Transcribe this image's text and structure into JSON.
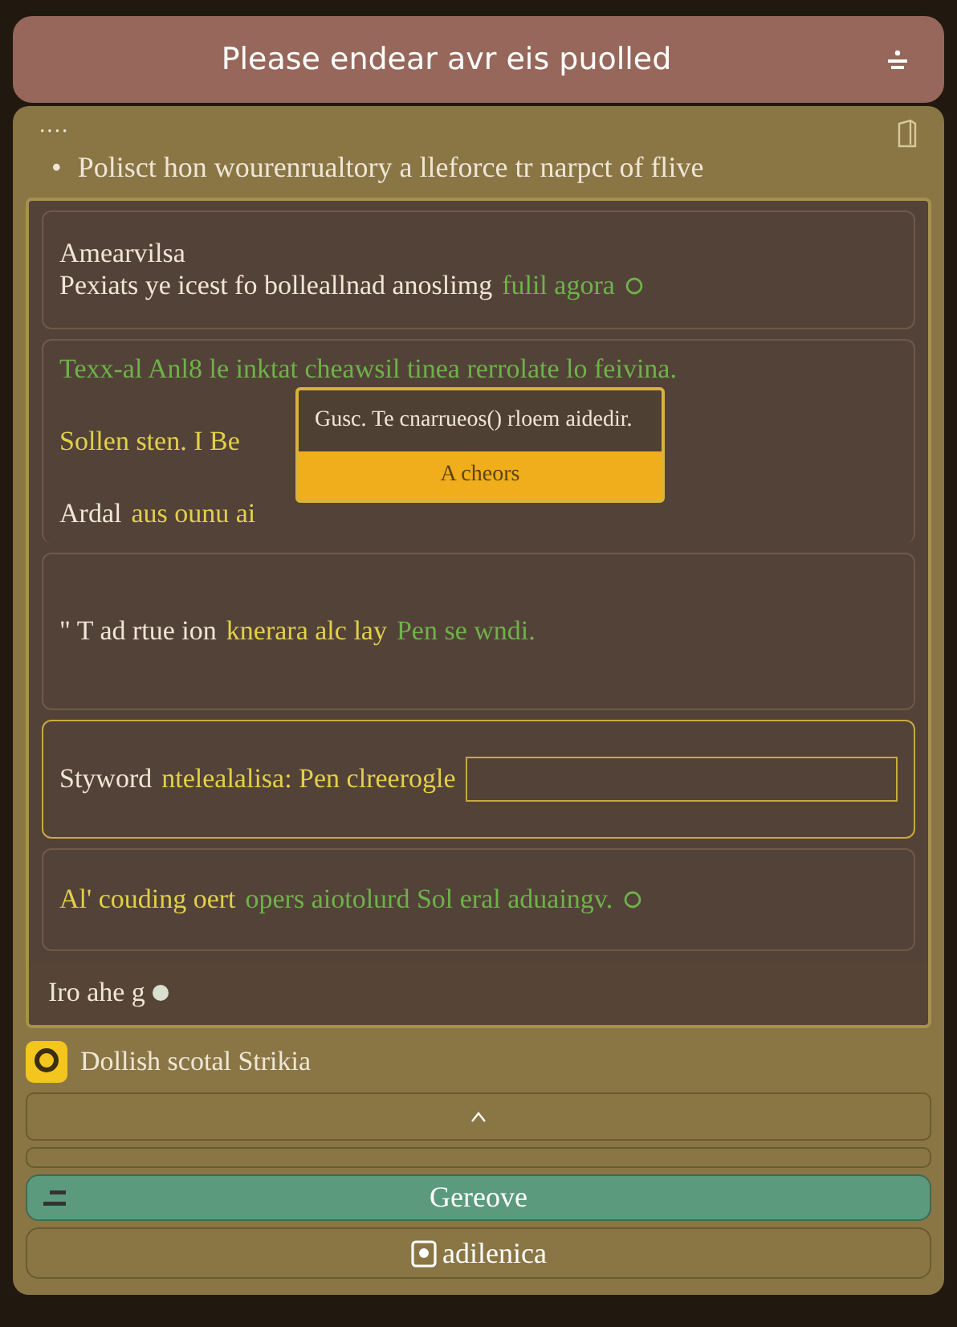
{
  "header": {
    "title": "Please endear avr eis puolled"
  },
  "panel": {
    "dots": "····",
    "bullet": "•",
    "intro": "Polisct hon wourenrualtory a lleforce tr narpct of flive"
  },
  "cards": [
    {
      "kind": "text",
      "title": "Amearvilsa",
      "lines": [
        [
          {
            "kind": "plain",
            "text": "Pexiats ye icest fo bolleallnad anoslimg"
          },
          {
            "kind": "green",
            "text": "fulil agora"
          }
        ]
      ],
      "icon": true
    },
    {
      "kind": "text",
      "lines": [
        [
          {
            "kind": "green",
            "text": "Texx-al Anl8 le inktat cheawsil tinea rerrolate lo feivina."
          }
        ],
        [
          {
            "kind": "yellow",
            "text": "Sollen sten. I Be"
          }
        ],
        [
          {
            "kind": "plain",
            "text": "Ardal"
          },
          {
            "kind": "yellow",
            "text": "aus ounu ai"
          }
        ]
      ],
      "icon": false
    },
    {
      "kind": "text",
      "lines": [
        [
          {
            "kind": "plain",
            "text": "\" T ad rtue ion"
          },
          {
            "kind": "yellow",
            "text": "knerara alc lay"
          },
          {
            "kind": "green",
            "text": "Pen se wndi."
          }
        ]
      ],
      "icon": false
    },
    {
      "kind": "field",
      "lines": [
        [
          {
            "kind": "plain",
            "text": "Styword"
          },
          {
            "kind": "yellow",
            "text": "ntelealalisa: Pen clreerogle"
          }
        ]
      ],
      "icon": false
    },
    {
      "kind": "text",
      "lines": [
        [
          {
            "kind": "yellow",
            "text": "Al' couding oert"
          },
          {
            "kind": "green",
            "text": "opers aiotolurd Sol eral aduaingv."
          }
        ]
      ],
      "icon": true
    }
  ],
  "popover": {
    "text": "Gusc. Te cnarrueos() rloem aidedir.",
    "button": "A cheors"
  },
  "footer_bar": {
    "text": "Iro ahe g"
  },
  "section": {
    "label": "Dollish scotal Strikia"
  },
  "buttons": [
    {
      "kind": "primary",
      "label": "Gereove"
    },
    {
      "kind": "secondary",
      "label": "adilenica"
    }
  ]
}
